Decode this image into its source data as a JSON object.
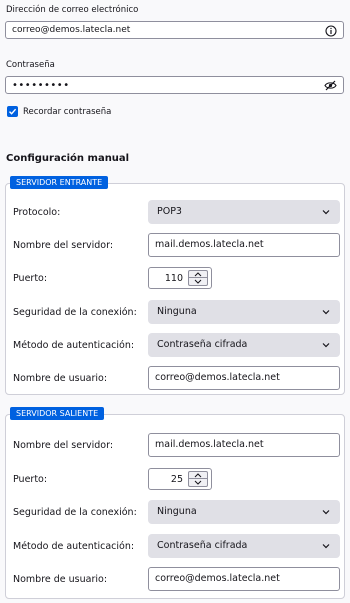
{
  "account": {
    "email_label": "Dirección de correo electrónico",
    "email_value": "correo@demos.latecla.net",
    "password_label": "Contraseña",
    "password_value": "•••••••••",
    "remember_label": "Recordar contraseña",
    "remember_checked": true
  },
  "manual": {
    "title": "Configuración manual",
    "incoming": {
      "legend": "SERVIDOR ENTRANTE",
      "protocol_label": "Protocolo:",
      "protocol_value": "POP3",
      "hostname_label": "Nombre del servidor:",
      "hostname_value": "mail.demos.latecla.net",
      "port_label": "Puerto:",
      "port_value": "110",
      "security_label": "Seguridad de la conexión:",
      "security_value": "Ninguna",
      "auth_label": "Método de autenticación:",
      "auth_value": "Contraseña cifrada",
      "username_label": "Nombre de usuario:",
      "username_value": "correo@demos.latecla.net"
    },
    "outgoing": {
      "legend": "SERVIDOR SALIENTE",
      "hostname_label": "Nombre del servidor:",
      "hostname_value": "mail.demos.latecla.net",
      "port_label": "Puerto:",
      "port_value": "25",
      "security_label": "Seguridad de la conexión:",
      "security_value": "Ninguna",
      "auth_label": "Método de autenticación:",
      "auth_value": "Contraseña cifrada",
      "username_label": "Nombre de usuario:",
      "username_value": "correo@demos.latecla.net"
    }
  },
  "icons": {
    "email_info": "info-icon",
    "password_toggle": "eye-slash-icon",
    "check": "checkmark-icon",
    "dropdown": "chevron-down-icon",
    "step_up": "caret-up-icon",
    "step_down": "caret-down-icon"
  },
  "colors": {
    "accent": "#0061e0",
    "background": "#f9f9fb",
    "select_bg": "#e0e0e6"
  }
}
